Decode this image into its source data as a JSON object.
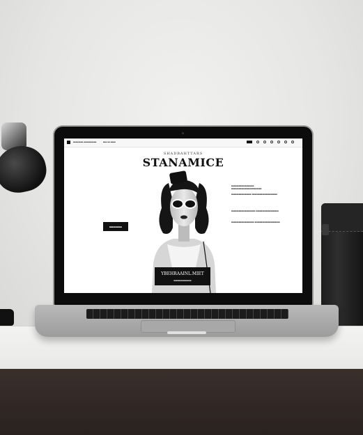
{
  "browser": {
    "title_text": "■■■■■■■■ ■■■■■■■■■■",
    "nav_text": "■■■ ■■ ■■■■"
  },
  "site": {
    "supertitle": "SHADBAHTTARS",
    "title": "STANAMICE",
    "left_button_label": "■■■■■■■■■■",
    "caption_title": "YBEHRAAINL.MIET",
    "caption_sub": "■■■■■■■■■■■■■■"
  },
  "text_blocks": [
    "■■■■■■■■■■■■■■■■■■ ■■■■■■■■■■■■■■■■■■■■■■■■",
    "■■■■■■■■■■■■■■■■ ■■■■■■■■■■■■■■■■■■■■",
    "■■■■■■■■■■■■■■■■■■■ ■■■■■■■■■■■■■■■■■■",
    "■■■■■■■■■■■■■■■■■■ ■■■■■■■■■■■■■■■■■■■■"
  ],
  "colors": {
    "page_background": "#ffffff",
    "accent": "#111111",
    "desk_front": "#2a221f"
  }
}
